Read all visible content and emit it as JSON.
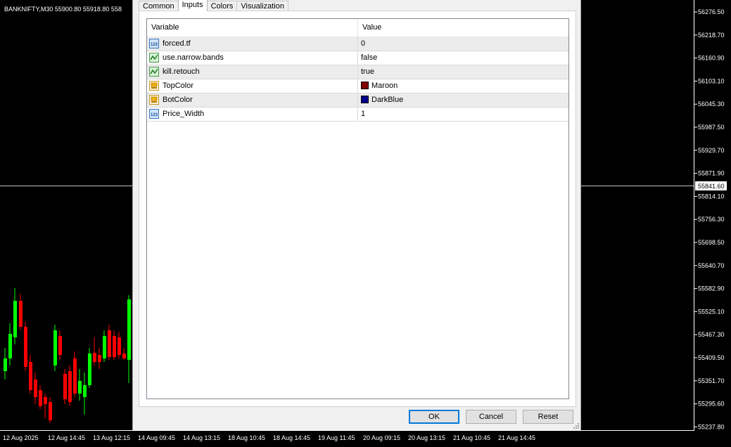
{
  "chart": {
    "title": "BANKNIFTY,M30  55900.80 55918.80 558",
    "price_ticks": [
      "56276.50",
      "56218.70",
      "56160.90",
      "56103.10",
      "56045.30",
      "55987.50",
      "55929.70",
      "55871.90",
      "55814.10",
      "55756.30",
      "55698.50",
      "55640.70",
      "55582.90",
      "55525.10",
      "55467.30",
      "55409.50",
      "55351.70",
      "55295.60",
      "55237.80"
    ],
    "current_price": "55841.60",
    "time_ticks": [
      "12 Aug 2025",
      "12 Aug 14:45",
      "13 Aug 12:15",
      "14 Aug 09:45",
      "14 Aug 13:15",
      "18 Aug 10:45",
      "18 Aug 14:45",
      "19 Aug 11:45",
      "20 Aug 09:15",
      "20 Aug 13:15",
      "21 Aug 10:45",
      "21 Aug 14:45"
    ],
    "colors": {
      "up": "#00ff00",
      "down": "#ff0000",
      "background": "#000000",
      "axis_text": "#ffffff"
    }
  },
  "dialog": {
    "tabs": [
      {
        "label": "Common",
        "active": false
      },
      {
        "label": "Inputs",
        "active": true
      },
      {
        "label": "Colors",
        "active": false
      },
      {
        "label": "Visualization",
        "active": false
      }
    ],
    "grid": {
      "headers": {
        "variable": "Variable",
        "value": "Value"
      },
      "rows": [
        {
          "icon": "number-icon",
          "variable": "forced.tf",
          "value": "0"
        },
        {
          "icon": "bool-icon",
          "variable": "use.narrow.bands",
          "value": "false"
        },
        {
          "icon": "bool-icon",
          "variable": "kill.retouch",
          "value": "true"
        },
        {
          "icon": "color-icon",
          "variable": "TopColor",
          "value": "Maroon",
          "swatch": "#800000"
        },
        {
          "icon": "color-icon",
          "variable": "BotColor",
          "value": "DarkBlue",
          "swatch": "#00008b"
        },
        {
          "icon": "number-icon",
          "variable": "Price_Width",
          "value": "1"
        }
      ]
    },
    "buttons": {
      "ok": "OK",
      "cancel": "Cancel",
      "reset": "Reset"
    }
  }
}
